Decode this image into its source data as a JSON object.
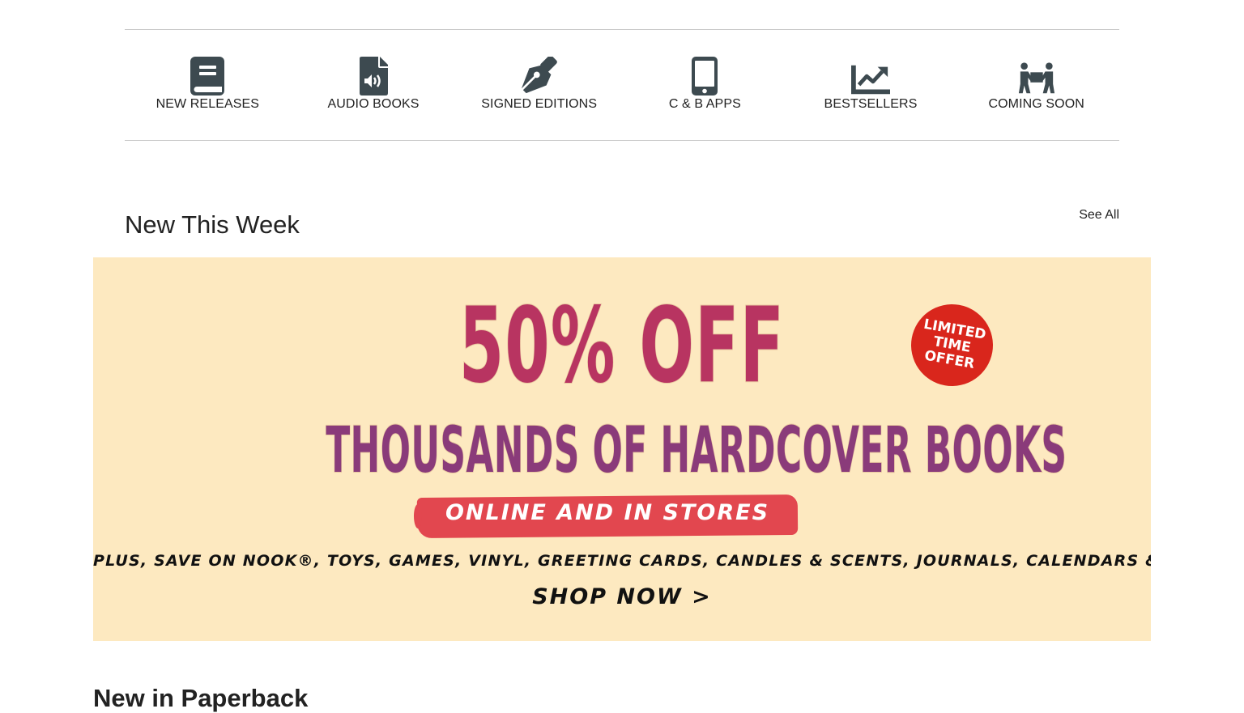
{
  "nav": {
    "items": [
      {
        "label": "NEW RELEASES",
        "icon": "book-icon"
      },
      {
        "label": "AUDIO BOOKS",
        "icon": "audio-file-icon"
      },
      {
        "label": "SIGNED EDITIONS",
        "icon": "pen-nib-icon"
      },
      {
        "label": "C & B APPS",
        "icon": "mobile-phone-icon"
      },
      {
        "label": "BESTSELLERS",
        "icon": "trending-chart-icon"
      },
      {
        "label": "COMING SOON",
        "icon": "people-carry-box-icon"
      }
    ],
    "icon_color": "#3d4a50"
  },
  "new_this_week": {
    "title": "New This Week",
    "see_all": "See All"
  },
  "banner": {
    "headline": "50% OFF",
    "subline": "THOUSANDS OF HARDCOVER BOOKS",
    "badge_line1": "LIMITED",
    "badge_line2": "TIME",
    "badge_line3": "OFFER",
    "brush_text": "ONLINE AND IN STORES",
    "plus_line": "PLUS, SAVE ON NOOK®, TOYS, GAMES, VINYL, GREETING CARDS, CANDLES & SCENTS, JOURNALS, CALENDARS & MORE!",
    "shop_now": "SHOP NOW >",
    "background": "#fde9c0",
    "badge_color": "#d9261c",
    "brush_color": "#e2474f"
  },
  "next_section": {
    "title": "New in Paperback"
  }
}
